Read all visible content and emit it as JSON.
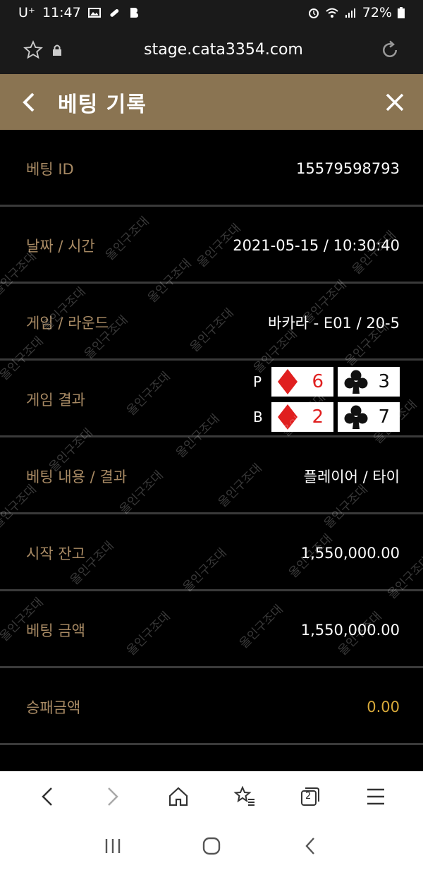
{
  "status_bar": {
    "carrier": "U⁺",
    "time": "11:47",
    "battery": "72%"
  },
  "browser": {
    "url": "stage.cata3354.com"
  },
  "header": {
    "title": "베팅 기록"
  },
  "rows": [
    {
      "label": "베팅 ID",
      "value": "15579598793"
    },
    {
      "label": "날짜 / 시간",
      "value": "2021-05-15 / 10:30:40"
    },
    {
      "label": "게임 / 라운드",
      "value": "바카라 - E01 / 20-5"
    },
    {
      "label": "게임 결과"
    },
    {
      "label": "베팅 내용 / 결과",
      "value": "플레이어 / 타이"
    },
    {
      "label": "시작 잔고",
      "value": "1,550,000.00"
    },
    {
      "label": "베팅 금액",
      "value": "1,550,000.00"
    },
    {
      "label": "승패금액",
      "value": "0.00"
    }
  ],
  "game_result": {
    "player": {
      "label": "P",
      "cards": [
        {
          "suit": "diamond",
          "rank": "6"
        },
        {
          "suit": "club",
          "rank": "3"
        }
      ]
    },
    "banker": {
      "label": "B",
      "cards": [
        {
          "suit": "diamond",
          "rank": "2"
        },
        {
          "suit": "club",
          "rank": "7"
        }
      ]
    }
  },
  "watermark": "올인구조대",
  "toolbar": {
    "tab_count": "2"
  },
  "colors": {
    "header_bg": "#8a7452",
    "label": "#a88a64",
    "gold_value": "#d7a93a"
  }
}
